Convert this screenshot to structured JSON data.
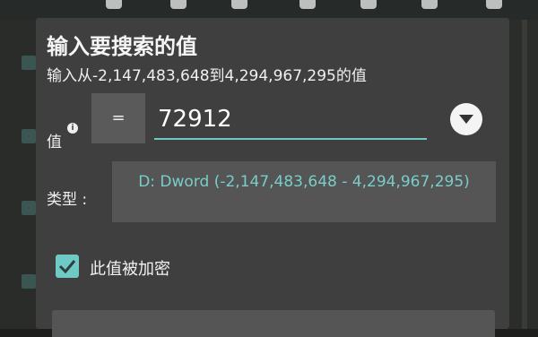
{
  "dialog": {
    "title": "输入要搜索的值",
    "subtitle": "输入从-2,147,483,648到4,294,967,295的值",
    "value_label": "值",
    "info_icon": "i",
    "operator": "=",
    "value_input": "72912",
    "type_label": "类型 :",
    "type_value": "D: Dword (-2,147,483,648 - 4,294,967,295)",
    "encrypted_label": "此值被加密",
    "encrypted_checked": true
  },
  "icons": [
    "info-icon",
    "chevron-down-icon",
    "checkmark-icon"
  ],
  "colors": {
    "accent": "#6fc9c5",
    "dialog_bg": "#3f3f3f"
  }
}
